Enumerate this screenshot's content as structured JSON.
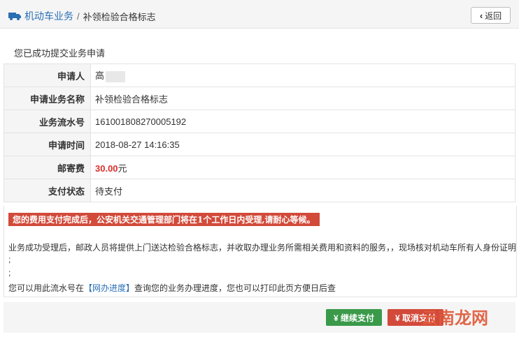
{
  "breadcrumb": {
    "link": "机动车业务",
    "separator": "/",
    "current": "补领检验合格标志"
  },
  "back_button": {
    "label": "返回"
  },
  "message": "您已成功提交业务申请",
  "rows": [
    {
      "label": "申请人",
      "value": "高"
    },
    {
      "label": "申请业务名称",
      "value": "补领检验合格标志"
    },
    {
      "label": "业务流水号",
      "value": "161001808270005192"
    },
    {
      "label": "申请时间",
      "value": "2018-08-27 14:16:35"
    },
    {
      "label": "邮寄费",
      "amount": "30.00",
      "unit": "元"
    },
    {
      "label": "支付状态",
      "value": "待支付"
    }
  ],
  "notice": {
    "alert": "您的费用支付完成后，公安机关交通管理部门将在1个工作日内受理,请耐心等候。",
    "para1": "业务成功受理后，邮政人员将提供上门送达检验合格标志，并收取办理业务所需相关费用和资料的服务，，现场核对机动车所有人身份证明",
    "line2": ";",
    "line3": ";",
    "para4_prefix": "您可以用此流水号在",
    "para4_link": "【网办进度】",
    "para4_suffix": "查询您的业务办理进度，您也可以打印此页方便日后查"
  },
  "buttons": {
    "continue_pay": "¥ 继续支付",
    "cancel_pay": "¥ 取消支付"
  },
  "watermark": "云南龙网",
  "colors": {
    "link": "#2a6fb5",
    "fee": "#d9302b",
    "alert_bg": "#d24a3a",
    "green": "#3a9a4a"
  }
}
